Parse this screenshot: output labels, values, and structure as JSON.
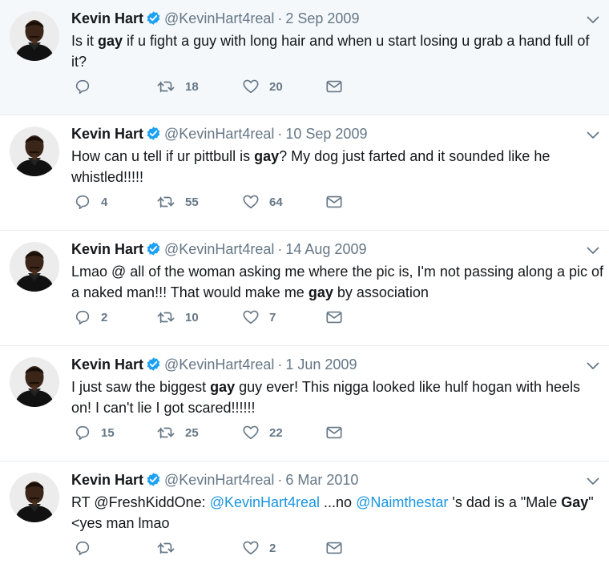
{
  "tweets": [
    {
      "name": "Kevin Hart",
      "handle": "@KevinHart4real",
      "date": "2 Sep 2009",
      "text_parts": [
        {
          "t": "Is it ",
          "b": false
        },
        {
          "t": "gay",
          "b": true
        },
        {
          "t": " if u fight a guy with long hair and when u start losing u grab a hand full of it?",
          "b": false
        }
      ],
      "replies": "",
      "retweets": "18",
      "likes": "20"
    },
    {
      "name": "Kevin Hart",
      "handle": "@KevinHart4real",
      "date": "10 Sep 2009",
      "text_parts": [
        {
          "t": "How can u tell if ur pittbull is ",
          "b": false
        },
        {
          "t": "gay",
          "b": true
        },
        {
          "t": "? My dog just farted and it sounded like he whistled!!!!!",
          "b": false
        }
      ],
      "replies": "4",
      "retweets": "55",
      "likes": "64"
    },
    {
      "name": "Kevin Hart",
      "handle": "@KevinHart4real",
      "date": "14 Aug 2009",
      "text_parts": [
        {
          "t": "Lmao @ all of the woman asking me where the pic is, I'm not passing along a pic of a naked man!!! That would make me ",
          "b": false
        },
        {
          "t": "gay",
          "b": true
        },
        {
          "t": " by association",
          "b": false
        }
      ],
      "replies": "2",
      "retweets": "10",
      "likes": "7"
    },
    {
      "name": "Kevin Hart",
      "handle": "@KevinHart4real",
      "date": "1 Jun 2009",
      "text_parts": [
        {
          "t": "I just saw the biggest ",
          "b": false
        },
        {
          "t": "gay",
          "b": true
        },
        {
          "t": " guy ever! This nigga looked like hulf hogan with heels on! I can't lie I got scared!!!!!!",
          "b": false
        }
      ],
      "replies": "15",
      "retweets": "25",
      "likes": "22"
    },
    {
      "name": "Kevin Hart",
      "handle": "@KevinHart4real",
      "date": "6 Mar 2010",
      "text_parts": [
        {
          "t": "RT @FreshKiddOne: ",
          "b": false
        },
        {
          "t": "@KevinHart4real",
          "b": false,
          "link": true
        },
        {
          "t": " ...no ",
          "b": false
        },
        {
          "t": "@Naimthestar",
          "b": false,
          "link": true
        },
        {
          "t": " 's dad is a \"Male ",
          "b": false
        },
        {
          "t": "Gay",
          "b": true
        },
        {
          "t": "\" <yes man lmao",
          "b": false
        }
      ],
      "replies": "",
      "retweets": "",
      "likes": "2"
    }
  ],
  "ui": {
    "separator": "·",
    "icons": [
      "reply-icon",
      "retweet-icon",
      "like-icon",
      "direct-message-icon",
      "verified-badge-icon",
      "caret-down-icon"
    ],
    "colors": {
      "text": "#14171a",
      "muted": "#657786",
      "link": "#1b95e0",
      "verified": "#1da1f2",
      "highlight_bg": "#f5f8fa",
      "border": "#e6ecf0"
    }
  }
}
